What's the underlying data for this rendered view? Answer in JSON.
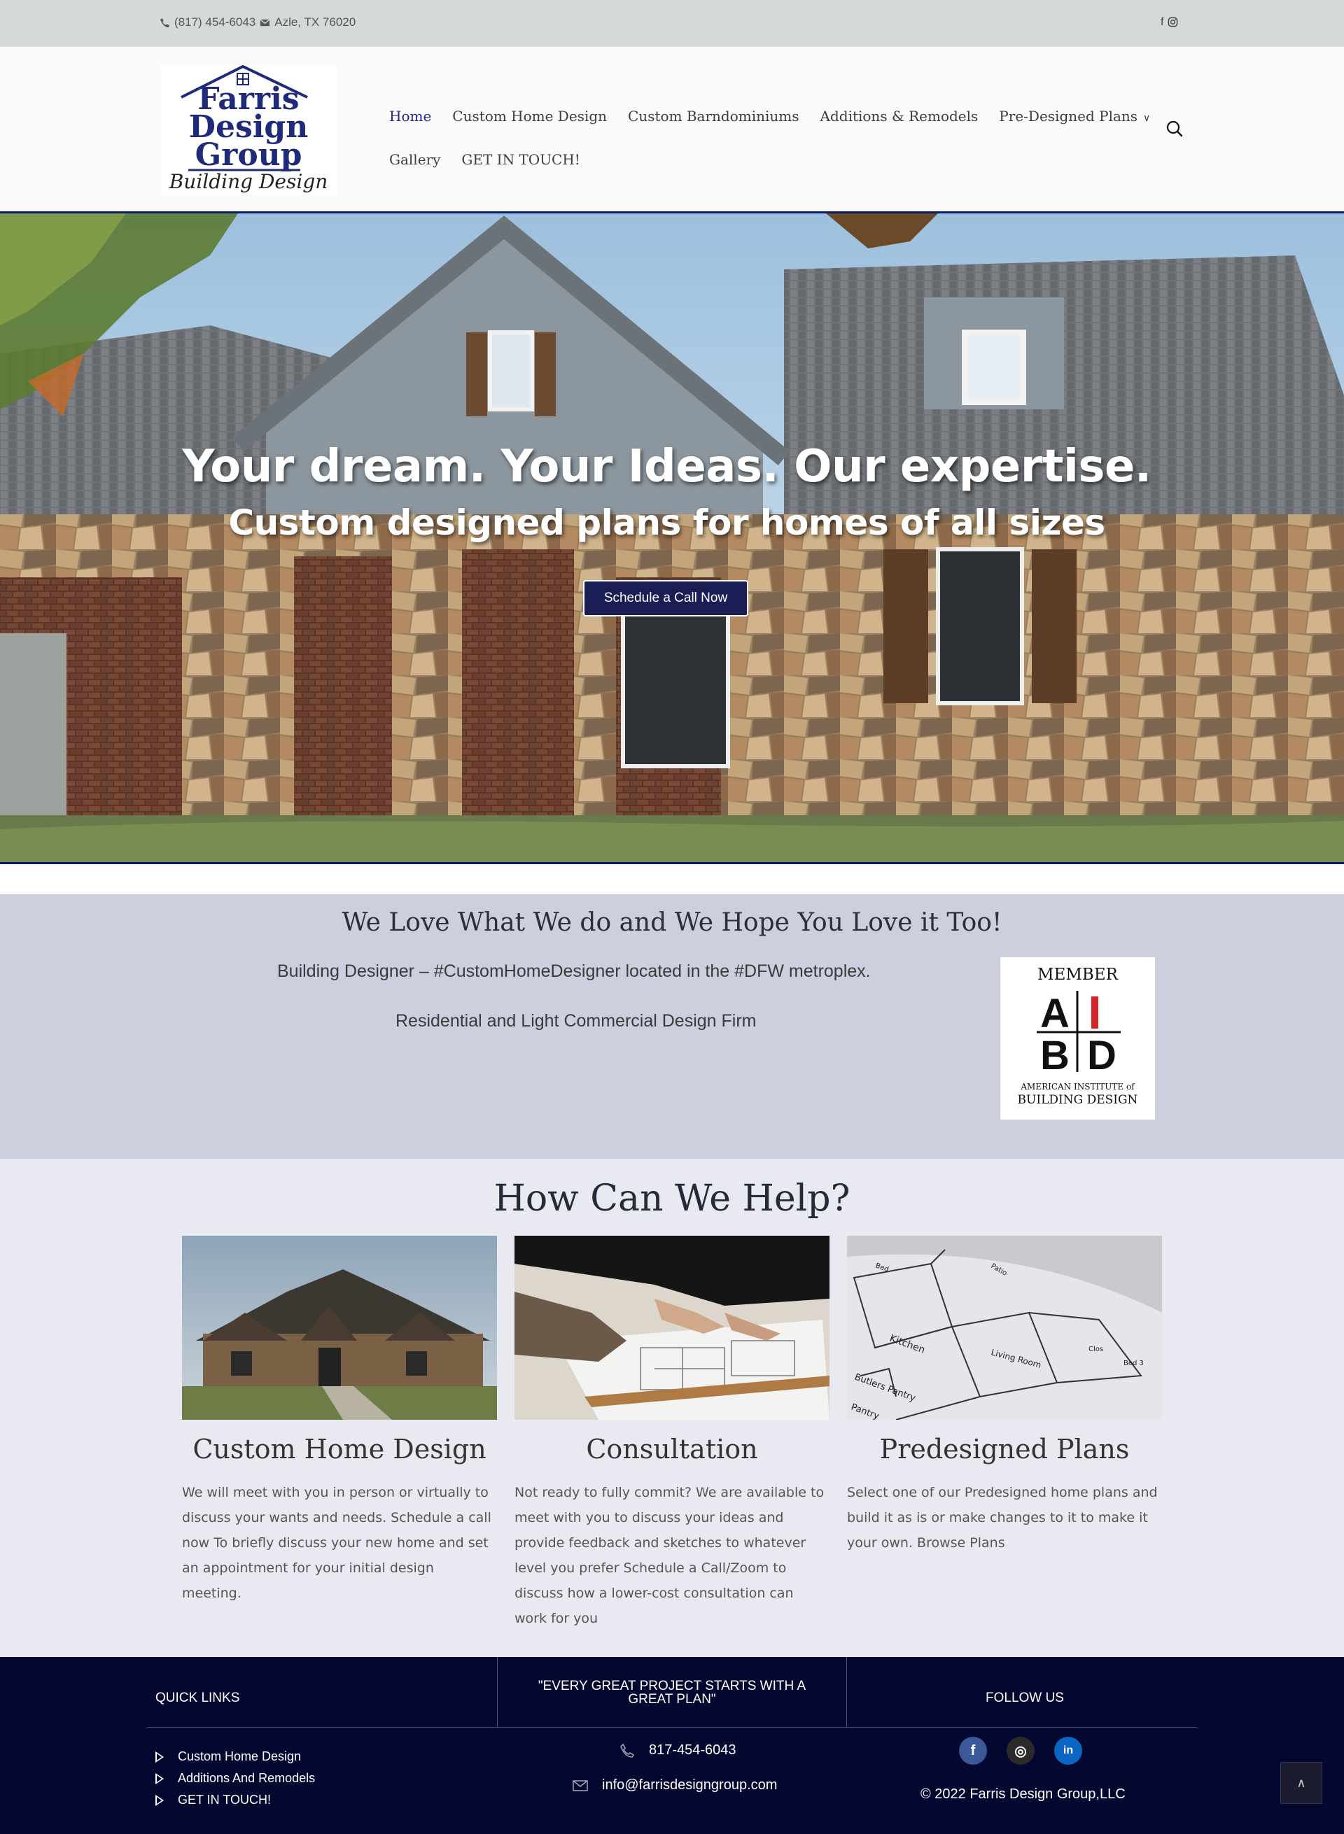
{
  "topbar": {
    "phone": "(817) 454-6043",
    "location": "Azle, TX 76020",
    "social_icons": [
      "facebook-icon",
      "instagram-icon"
    ]
  },
  "logo": {
    "line1": "Farris",
    "line2": "Design",
    "line3": "Group",
    "tagline": "Building Design"
  },
  "nav": {
    "items": [
      {
        "label": "Home",
        "active": true
      },
      {
        "label": "Custom Home Design"
      },
      {
        "label": "Custom Barndominiums"
      },
      {
        "label": "Additions & Remodels"
      },
      {
        "label": "Pre-Designed Plans"
      },
      {
        "label": "Gallery"
      },
      {
        "label": "GET IN TOUCH!"
      }
    ],
    "accent_color": "#1f2a8a"
  },
  "hero": {
    "headline": "Your dream. Your Ideas. Our expertise.",
    "subheadline": "Custom designed plans for homes of all sizes",
    "cta_label": "Schedule a Call Now"
  },
  "about": {
    "heading": "We Love What We do and We Hope You Love it Too!",
    "line1": "Building Designer – #CustomHomeDesigner located in the #DFW metroplex.",
    "line2": "Residential and Light Commercial Design Firm",
    "badge": {
      "top": "MEMBER",
      "letters_top": "A I",
      "letters_bottom": "B D",
      "org_line1": "AMERICAN INSTITUTE of",
      "org_line2": "BUILDING DESIGN"
    }
  },
  "help": {
    "heading": "How Can We Help?",
    "cards": [
      {
        "title": "Custom Home Design",
        "text": "We will meet with you in person or virtually to discuss your wants and needs. Schedule a call now To briefly discuss your new home and set an appointment for your initial design meeting."
      },
      {
        "title": "Consultation",
        "text": "Not ready to fully commit?  We are available to meet with you to discuss your ideas and provide feedback and sketches to whatever level you prefer  Schedule a Call/Zoom  to discuss how a lower-cost consultation can work for you"
      },
      {
        "title": "Predesigned Plans",
        "text": "Select one of our Predesigned home plans and build it as is or make changes to it to make it your own.  Browse Plans"
      }
    ]
  },
  "footer": {
    "quick_links_title": "QUICK LINKS",
    "quote": "\"EVERY GREAT PROJECT STARTS WITH A GREAT PLAN\"",
    "follow_title": "FOLLOW US",
    "links": [
      "Custom Home Design",
      "Additions And Remodels",
      "GET IN TOUCH!"
    ],
    "phone": "817-454-6043",
    "email": "info@farrisdesigngroup.com",
    "copyright": "© 2022 Farris Design Group,LLC",
    "social": [
      {
        "icon": "facebook-icon",
        "glyph": "f",
        "color": "#3b5998"
      },
      {
        "icon": "instagram-icon",
        "glyph": "◎",
        "color": "#2a2a2a"
      },
      {
        "icon": "linkedin-icon",
        "glyph": "in",
        "color": "#0a66c2"
      }
    ],
    "background": "#040730"
  }
}
